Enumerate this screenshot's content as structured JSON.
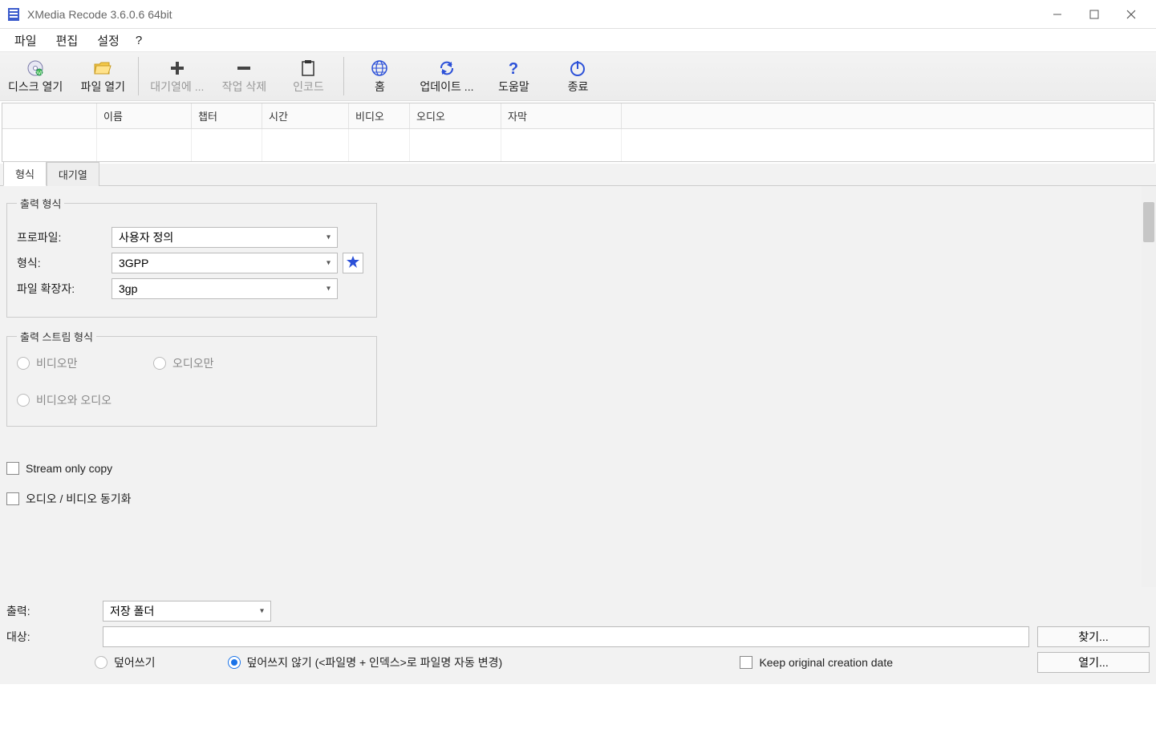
{
  "titlebar": {
    "title": "XMedia Recode 3.6.0.6 64bit"
  },
  "menubar": {
    "file": "파일",
    "edit": "편집",
    "settings": "설정",
    "help": "?"
  },
  "toolbar": {
    "open_disc": "디스크 열기",
    "open_file": "파일 열기",
    "add_queue": "대기열에 ...",
    "remove_job": "작업 삭제",
    "encode": "인코드",
    "home": "홈",
    "update": "업데이트 ...",
    "help": "도움말",
    "exit": "종료"
  },
  "grid": {
    "headers": {
      "col0": "",
      "name": "이름",
      "chapter": "챕터",
      "time": "시간",
      "video": "비디오",
      "audio": "오디오",
      "subtitle": "자막"
    }
  },
  "tabs": {
    "format": "형식",
    "queue": "대기열"
  },
  "output_format": {
    "legend": "출력 형식",
    "profile_label": "프로파일:",
    "profile_value": "사용자 정의",
    "format_label": "형식:",
    "format_value": "3GPP",
    "ext_label": "파일 확장자:",
    "ext_value": "3gp"
  },
  "stream_format": {
    "legend": "출력 스트림 형식",
    "video_only": "비디오만",
    "audio_only": "오디오만",
    "video_audio": "비디오와 오디오"
  },
  "checks": {
    "stream_only_copy": "Stream only copy",
    "av_sync": "오디오 / 비디오 동기화"
  },
  "bottom": {
    "output_label": "출력:",
    "output_value": "저장 폴더",
    "target_label": "대상:",
    "browse_btn": "찾기...",
    "open_btn": "열기...",
    "overwrite": "덮어쓰기",
    "no_overwrite": "덮어쓰지 않기 (<파일명 + 인덱스>로 파일명 자동 변경)",
    "keep_date": "Keep original creation date"
  }
}
